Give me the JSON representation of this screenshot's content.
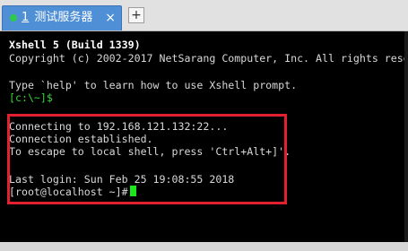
{
  "tab": {
    "number": "1",
    "title": "测试服务器",
    "close": "×",
    "status_color": "#2ecb4a"
  },
  "new_tab": {
    "label": "+"
  },
  "terminal": {
    "header": "Xshell 5 (Build 1339)",
    "copyright": "Copyright (c) 2002-2017 NetSarang Computer, Inc. All rights reserved.",
    "help": "Type `help' to learn how to use Xshell prompt.",
    "local_prompt": "[c:\\~]$",
    "connecting": "Connecting to 192.168.121.132:22...",
    "established": "Connection established.",
    "escape": "To escape to local shell, press 'Ctrl+Alt+]'.",
    "last_login": "Last login: Sun Feb 25 19:08:55 2018",
    "remote_prompt": "[root@localhost ~]#"
  },
  "colors": {
    "tab_active": "#4f8fd6",
    "terminal_bg": "#000000",
    "prompt_green": "#38d438",
    "highlight_red": "#e2202f",
    "cursor": "#1ae81a"
  }
}
